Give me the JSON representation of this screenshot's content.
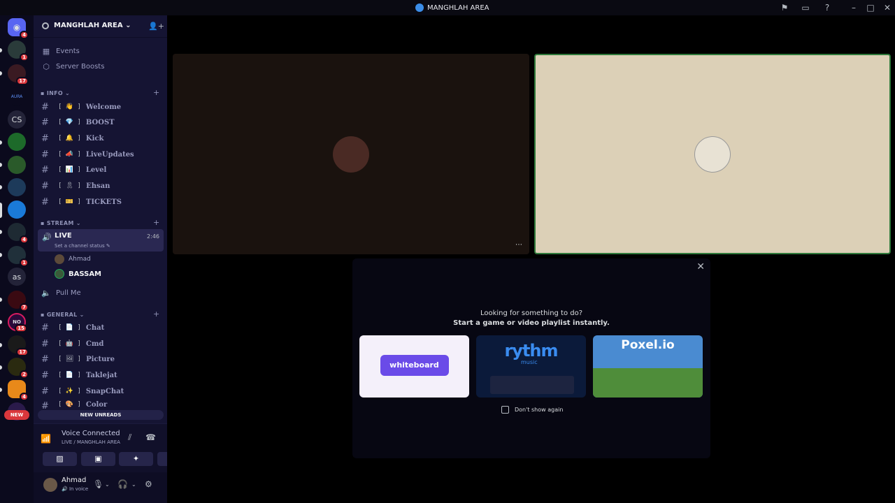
{
  "titlebar": {
    "title": "MANGHLAH AREA"
  },
  "rail": {
    "servers": [
      {
        "label": "",
        "badge": "4"
      },
      {
        "label": "",
        "badge": "1"
      },
      {
        "label": "",
        "badge": "17"
      },
      {
        "label": "AURA",
        "badge": ""
      },
      {
        "label": "CS",
        "badge": ""
      },
      {
        "label": "",
        "badge": ""
      },
      {
        "label": "",
        "badge": ""
      },
      {
        "label": "",
        "badge": ""
      },
      {
        "label": "",
        "badge": ""
      },
      {
        "label": "",
        "badge": "4"
      },
      {
        "label": "",
        "badge": "1"
      },
      {
        "label": "as",
        "badge": ""
      },
      {
        "label": "",
        "badge": "7"
      },
      {
        "label": "NO",
        "badge": "15"
      },
      {
        "label": "",
        "badge": "17"
      },
      {
        "label": "",
        "badge": "2"
      },
      {
        "label": "",
        "badge": "4"
      }
    ]
  },
  "server_header": {
    "name": "MANGHLAH AREA"
  },
  "top_items": [
    {
      "label": "Events"
    },
    {
      "label": "Server Boosts"
    }
  ],
  "categories": {
    "info": "INFO",
    "stream": "STREAM",
    "general": "GENERAL"
  },
  "info_channels": [
    {
      "emoji": "[ 👋 ]",
      "name": "Welcome"
    },
    {
      "emoji": "[ 💎 ]",
      "name": "BOOST"
    },
    {
      "emoji": "[ 🔔 ]",
      "name": "Kick"
    },
    {
      "emoji": "[ 📣 ]",
      "name": "LiveUpdates"
    },
    {
      "emoji": "[ 📊 ]",
      "name": "Level"
    },
    {
      "emoji": "[ 🎗 ]",
      "name": "Ehsan"
    },
    {
      "emoji": "[ 🎫 ]",
      "name": "TICKETS"
    }
  ],
  "live_channel": {
    "name": "LIVE",
    "status": "Set a channel status",
    "time": "2:46"
  },
  "voice_users": [
    {
      "name": "Ahmad"
    },
    {
      "name": "BASSAM"
    }
  ],
  "pull_me": {
    "name": "Pull Me"
  },
  "general_channels": [
    {
      "emoji": "[ 📄 ]",
      "name": "Chat"
    },
    {
      "emoji": "[ 🤖 ]",
      "name": "Cmd"
    },
    {
      "emoji": "[ 🖼 ]",
      "name": "Picture"
    },
    {
      "emoji": "[ 📄 ]",
      "name": "Taklejat"
    },
    {
      "emoji": "[ ✨ ]",
      "name": "SnapChat"
    },
    {
      "emoji": "[ 🎨 ]",
      "name": "Color"
    }
  ],
  "new_unreads": "NEW UNREADS",
  "new_badge": "NEW",
  "voice_panel": {
    "title": "Voice Connected",
    "subtitle": "LIVE / MANGHLAH AREA"
  },
  "user_panel": {
    "name": "Ahmad",
    "status": "In voice"
  },
  "activity": {
    "line1": "Looking for something to do?",
    "line2": "Start a game or video playlist instantly.",
    "cards": [
      {
        "label": "whiteboard",
        "sub": ""
      },
      {
        "label": "rythm",
        "sub": "music"
      },
      {
        "label": "Poxel.io",
        "sub": ""
      }
    ],
    "dont_show": "Don't show again"
  },
  "icons": {
    "rail_home": "discord-logo-icon",
    "events": "calendar-icon",
    "boosts": "boost-icon",
    "channel": "hash-icon",
    "speaker": "speaker-icon",
    "settings": "gear-icon"
  },
  "colors": {
    "accent": "#23a55a",
    "badge": "#da373c",
    "sidebar": "#151433",
    "rail": "#0b0a1d"
  }
}
